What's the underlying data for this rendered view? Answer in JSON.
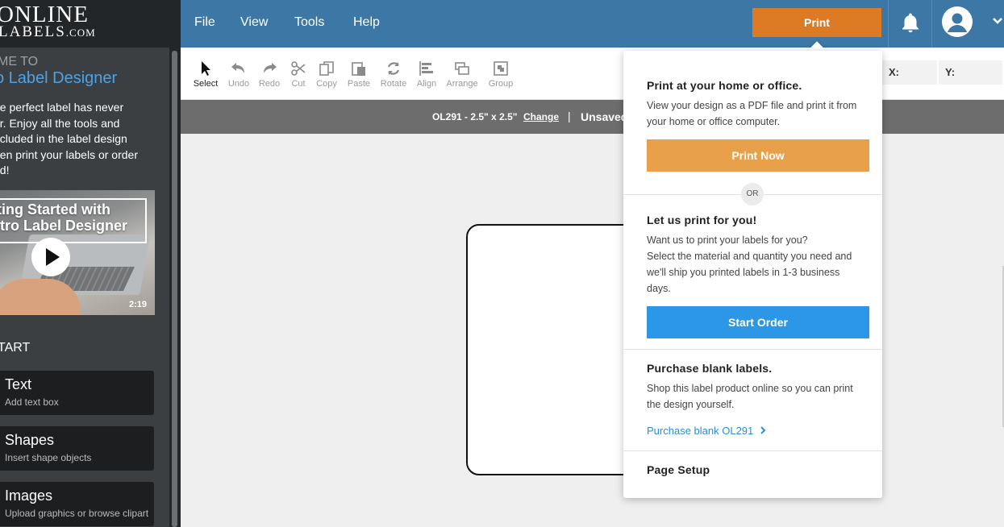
{
  "brand": {
    "line1": "ONLINE",
    "line2": "LABELS",
    "suffix": ".COM"
  },
  "sidebar": {
    "welcome_small": "ME TO",
    "welcome_big": "o Label Designer",
    "intro_lines": [
      "he perfect label has never",
      "er. Enjoy all the tools and",
      "ncluded in the label design",
      "hen print your labels or order",
      "ed!"
    ],
    "video": {
      "title_line1": "tting Started with",
      "title_line2": "stro Label Designer",
      "duration": "2:19"
    },
    "start_label": "TART",
    "tools": [
      {
        "title": "Text",
        "subtitle": "Add text box"
      },
      {
        "title": "Shapes",
        "subtitle": "Insert shape objects"
      },
      {
        "title": "Images",
        "subtitle": "Upload graphics or browse clipart"
      }
    ]
  },
  "menu": {
    "file": "File",
    "view": "View",
    "tools": "Tools",
    "help": "Help",
    "print": "Print"
  },
  "toolbar": {
    "select": "Select",
    "undo": "Undo",
    "redo": "Redo",
    "cut": "Cut",
    "copy": "Copy",
    "paste": "Paste",
    "rotate": "Rotate",
    "align": "Align",
    "arrange": "Arrange",
    "group": "Group",
    "x_label": "X:",
    "y_label": "Y:"
  },
  "infobar": {
    "product": "OL291 - 2.5\" x 2.5\"",
    "change": "Change",
    "separator": "|",
    "status": "Unsaved"
  },
  "print_menu": {
    "home_title": "Print at your home or office.",
    "home_desc_1": "View your design as a PDF file and print it from",
    "home_desc_2": "your home or office computer.",
    "print_now": "Print Now",
    "or": "OR",
    "order_title": "Let us print for you!",
    "order_desc_1": "Want us to print your labels for you?",
    "order_desc_2": "Select the material and quantity you need and",
    "order_desc_3": "we'll ship you printed labels in 1-3 business",
    "order_desc_4": "days.",
    "start_order": "Start Order",
    "blank_title": "Purchase blank labels.",
    "blank_desc_1": "Shop this label product online so you can print",
    "blank_desc_2": "the design yourself.",
    "blank_link": "Purchase blank OL291",
    "page_setup": "Page Setup"
  },
  "colors": {
    "topbar": "#3c77a5",
    "print_button": "#dc7b23",
    "print_now": "#e8a04a",
    "start_order": "#2b97e6",
    "link": "#2c8fd6"
  }
}
